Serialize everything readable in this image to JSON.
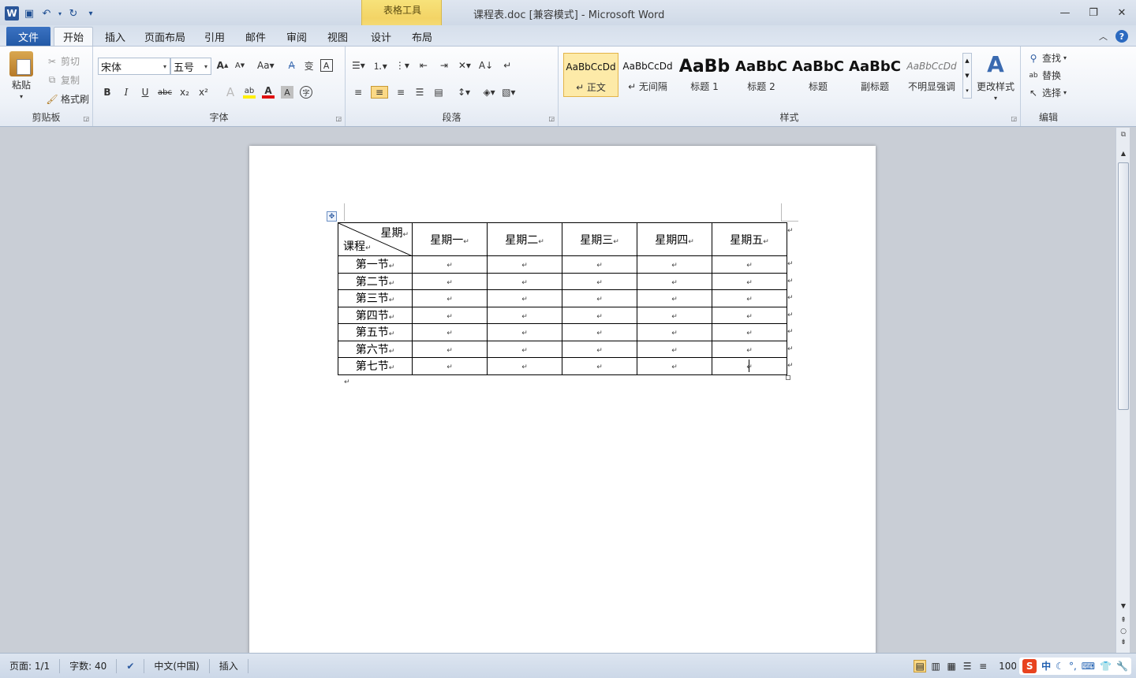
{
  "app": {
    "title": "课程表.doc [兼容模式]  -  Microsoft Word",
    "contextual_tab_group": "表格工具"
  },
  "qat": {
    "logo": "W",
    "save": "save-icon",
    "undo": "undo-icon",
    "redo": "redo-icon",
    "customize": "▾"
  },
  "tabs": [
    "文件",
    "开始",
    "插入",
    "页面布局",
    "引用",
    "邮件",
    "审阅",
    "视图",
    "设计",
    "布局"
  ],
  "ribbon": {
    "clipboard": {
      "label": "剪贴板",
      "paste": "粘贴",
      "cut": "剪切",
      "copy": "复制",
      "format_painter": "格式刷"
    },
    "font": {
      "label": "字体",
      "font_name": "宋体",
      "font_size": "五号"
    },
    "paragraph": {
      "label": "段落"
    },
    "styles": {
      "label": "样式",
      "items": [
        {
          "sample": "AaBbCcDd",
          "name": "↵ 正文"
        },
        {
          "sample": "AaBbCcDd",
          "name": "↵ 无间隔"
        },
        {
          "sample": "AaBb",
          "name": "标题 1"
        },
        {
          "sample": "AaBbC",
          "name": "标题 2"
        },
        {
          "sample": "AaBbC",
          "name": "标题"
        },
        {
          "sample": "AaBbC",
          "name": "副标题"
        },
        {
          "sample": "AaBbCcDd",
          "name": "不明显强调"
        }
      ],
      "change_styles": "更改样式"
    },
    "editing": {
      "label": "编辑",
      "find": "查找",
      "replace": "替换",
      "select": "选择"
    }
  },
  "table": {
    "corner_top": "星期",
    "corner_bottom": "课程",
    "headers": [
      "星期一",
      "星期二",
      "星期三",
      "星期四",
      "星期五"
    ],
    "rows": [
      "第一节",
      "第二节",
      "第三节",
      "第四节",
      "第五节",
      "第六节",
      "第七节"
    ],
    "mark": "↵"
  },
  "status": {
    "page": "页面: 1/1",
    "words": "字数: 40",
    "language": "中文(中国)",
    "mode": "插入",
    "zoom": "100"
  },
  "colors": {
    "file_tab": "#2a5fa8",
    "contextual": "#f3d466",
    "accent": "#2a5699"
  }
}
